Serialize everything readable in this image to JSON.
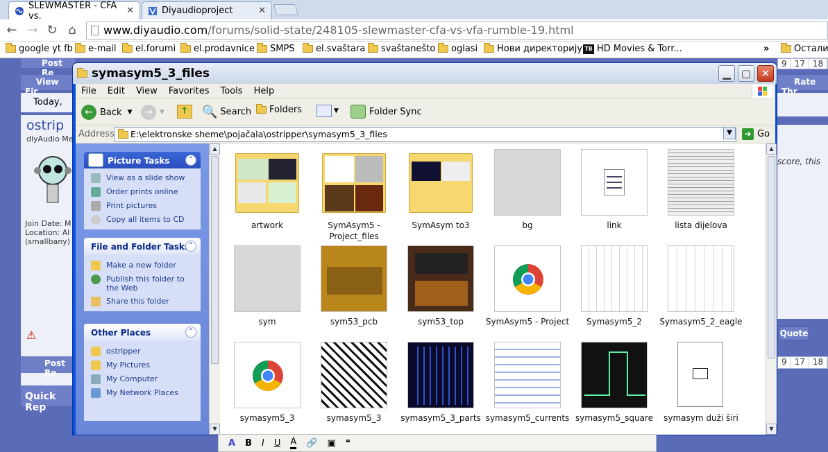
{
  "browser": {
    "tabs": [
      {
        "title": "SLEWMASTER - CFA vs.",
        "active": true
      },
      {
        "title": "Diyaudioproject",
        "active": false
      }
    ],
    "url_host": "www.diyaudio.com",
    "url_path": "/forums/solid-state/248105-slewmaster-cfa-vs-vfa-rumble-19.html",
    "bookmarks": [
      "google yt fb",
      "e-mail",
      "el.forumi",
      "el.prodavnice",
      "SMPS",
      "el.svaštara",
      "svaštanešto",
      "oglasi",
      "Нови директоријум",
      "HD Movies & Torr...",
      "Остали о"
    ],
    "overflow_label": "»"
  },
  "forum": {
    "post_reply": "Post Re",
    "view_first": "View Fir",
    "today": "Today,",
    "username": "ostrip",
    "member": "diyAudio Me",
    "join": "Join Date: M",
    "location": "Location: Al",
    "location2": "(smallbany)",
    "rate": "Rate Thr",
    "quote": "Quote",
    "quick_reply": "Quick Rep",
    "snippet_a": "score, this",
    "pages": [
      "9",
      "17",
      "18"
    ]
  },
  "explorer": {
    "title": "symasym5_3_files",
    "menu": [
      "File",
      "Edit",
      "View",
      "Favorites",
      "Tools",
      "Help"
    ],
    "toolbar": {
      "back": "Back",
      "search": "Search",
      "folders": "Folders",
      "folder_sync": "Folder Sync"
    },
    "address_label": "Address",
    "address": "E:\\elektronske sheme\\pojačala\\ostripper\\symasym5_3_files",
    "go": "Go",
    "picture_tasks": {
      "title": "Picture Tasks",
      "items": [
        "View as a slide show",
        "Order prints online",
        "Print pictures",
        "Copy all items to CD"
      ]
    },
    "file_tasks": {
      "title": "File and Folder Tasks",
      "items": [
        "Make a new folder",
        "Publish this folder to the Web",
        "Share this folder"
      ]
    },
    "other_places": {
      "title": "Other Places",
      "items": [
        "ostripper",
        "My Pictures",
        "My Computer",
        "My Network Places"
      ]
    },
    "files": [
      {
        "name": "artwork",
        "kind": "folder"
      },
      {
        "name": "SymAsym5 - Project_files",
        "kind": "folder"
      },
      {
        "name": "SymAsym to3",
        "kind": "folder"
      },
      {
        "name": "bg",
        "kind": "gray"
      },
      {
        "name": "link",
        "kind": "doc"
      },
      {
        "name": "lista dijelova",
        "kind": "table"
      },
      {
        "name": "sym",
        "kind": "gray"
      },
      {
        "name": "sym53_pcb",
        "kind": "pcb-photo"
      },
      {
        "name": "sym53_top",
        "kind": "photo-dark"
      },
      {
        "name": "SymAsym5 - Project",
        "kind": "chrome"
      },
      {
        "name": "Symasym5_2",
        "kind": "schematic"
      },
      {
        "name": "Symasym5_2_eagle",
        "kind": "schematic-red"
      },
      {
        "name": "symasym5_3",
        "kind": "chrome"
      },
      {
        "name": "symasym5_3",
        "kind": "pcb-bw"
      },
      {
        "name": "symasym5_3_parts",
        "kind": "pcb-dark"
      },
      {
        "name": "symasym5_currents",
        "kind": "schematic-blue"
      },
      {
        "name": "symasym5_square",
        "kind": "scope"
      },
      {
        "name": "symasym duži širi",
        "kind": "doc-sheet"
      }
    ]
  },
  "colors": {
    "xp_blue": "#0a55e0",
    "forum_bg": "#5a6cb8",
    "task_pane": "#6a86d8"
  }
}
